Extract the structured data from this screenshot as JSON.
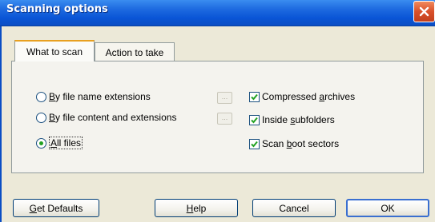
{
  "window": {
    "title": "Scanning options"
  },
  "tabs": [
    {
      "label": "What to scan",
      "active": true
    },
    {
      "label": "Action to take",
      "active": false
    }
  ],
  "scan_scope": {
    "options": [
      {
        "prefix": "",
        "accel": "B",
        "rest": "y file name extensions",
        "selected": false
      },
      {
        "prefix": "",
        "accel": "B",
        "rest": "y file content and extensions",
        "selected": false
      },
      {
        "prefix": "",
        "accel": "A",
        "rest": "ll files",
        "selected": true
      }
    ],
    "ellipsis_label": "..."
  },
  "checkboxes": [
    {
      "prefix": "Compressed ",
      "accel": "a",
      "rest": "rchives",
      "checked": true
    },
    {
      "prefix": "Inside ",
      "accel": "s",
      "rest": "ubfolders",
      "checked": true
    },
    {
      "prefix": "Scan ",
      "accel": "b",
      "rest": "oot sectors",
      "checked": true
    }
  ],
  "buttons": {
    "get_defaults": {
      "accel": "G",
      "rest": "et Defaults"
    },
    "help": {
      "accel": "H",
      "rest": "elp"
    },
    "cancel": {
      "label": "Cancel"
    },
    "ok": {
      "label": "OK"
    }
  },
  "colors": {
    "title_bar": "#0a55d6",
    "close": "#d9502a",
    "dialog_bg": "#ece9d8",
    "check_green": "#21a121"
  }
}
